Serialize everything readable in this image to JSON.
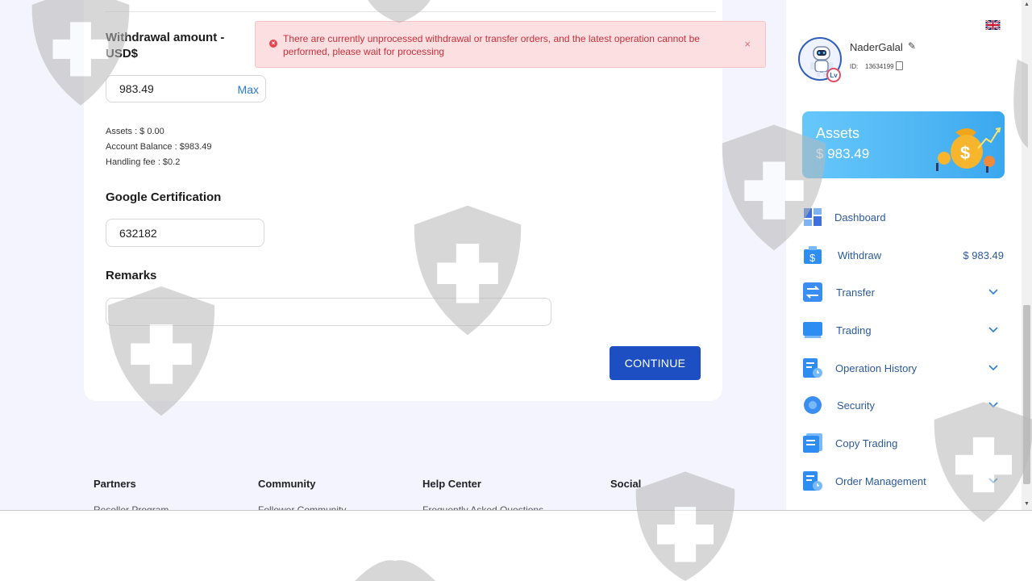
{
  "form": {
    "withdraw_label_line1": "Withdrawal amount -",
    "withdraw_label_line2": "USD$",
    "amount_value": "983.49",
    "max_label": "Max",
    "assets_line": "Assets : $ 0.00",
    "balance_line": "Account Balance : $983.49",
    "fee_line": "Handling fee : $0.2",
    "google_label": "Google Certification",
    "google_value": "632182",
    "remarks_label": "Remarks",
    "remarks_value": "",
    "continue_label": "CONTINUE"
  },
  "alert": {
    "message": "There are currently unprocessed withdrawal or transfer orders, and the latest operation cannot be performed, please wait for processing",
    "close": "×",
    "color": "#c9313b"
  },
  "footer": {
    "columns": [
      {
        "title": "Partners",
        "link": "Reseller Program"
      },
      {
        "title": "Community",
        "link": "Follower Community"
      },
      {
        "title": "Help Center",
        "link": "Frequently Asked Questions"
      },
      {
        "title": "Social",
        "link": ""
      }
    ]
  },
  "profile": {
    "username": "NaderGalal",
    "id_label": "ID:",
    "id_value": "13634199"
  },
  "assets": {
    "title": "Assets",
    "value": "$ 983.49"
  },
  "nav": [
    {
      "label": "Dashboard",
      "icon": "dashboard-icon",
      "value": "",
      "chevron": false
    },
    {
      "label": "Withdraw",
      "icon": "withdraw-icon",
      "value": "$ 983.49",
      "chevron": false
    },
    {
      "label": "Transfer",
      "icon": "transfer-icon",
      "value": "",
      "chevron": true
    },
    {
      "label": "Trading",
      "icon": "trading-icon",
      "value": "",
      "chevron": true
    },
    {
      "label": "Operation History",
      "icon": "history-icon",
      "value": "",
      "chevron": true
    },
    {
      "label": "Security",
      "icon": "security-icon",
      "value": "",
      "chevron": true
    },
    {
      "label": "Copy Trading",
      "icon": "copy-trading-icon",
      "value": "",
      "chevron": false
    },
    {
      "label": "Order Management",
      "icon": "order-management-icon",
      "value": "",
      "chevron": true
    }
  ],
  "colors": {
    "primary": "#1d4fc2",
    "nav_text": "#2b5a9e",
    "page_bg": "#f3f4fd"
  }
}
